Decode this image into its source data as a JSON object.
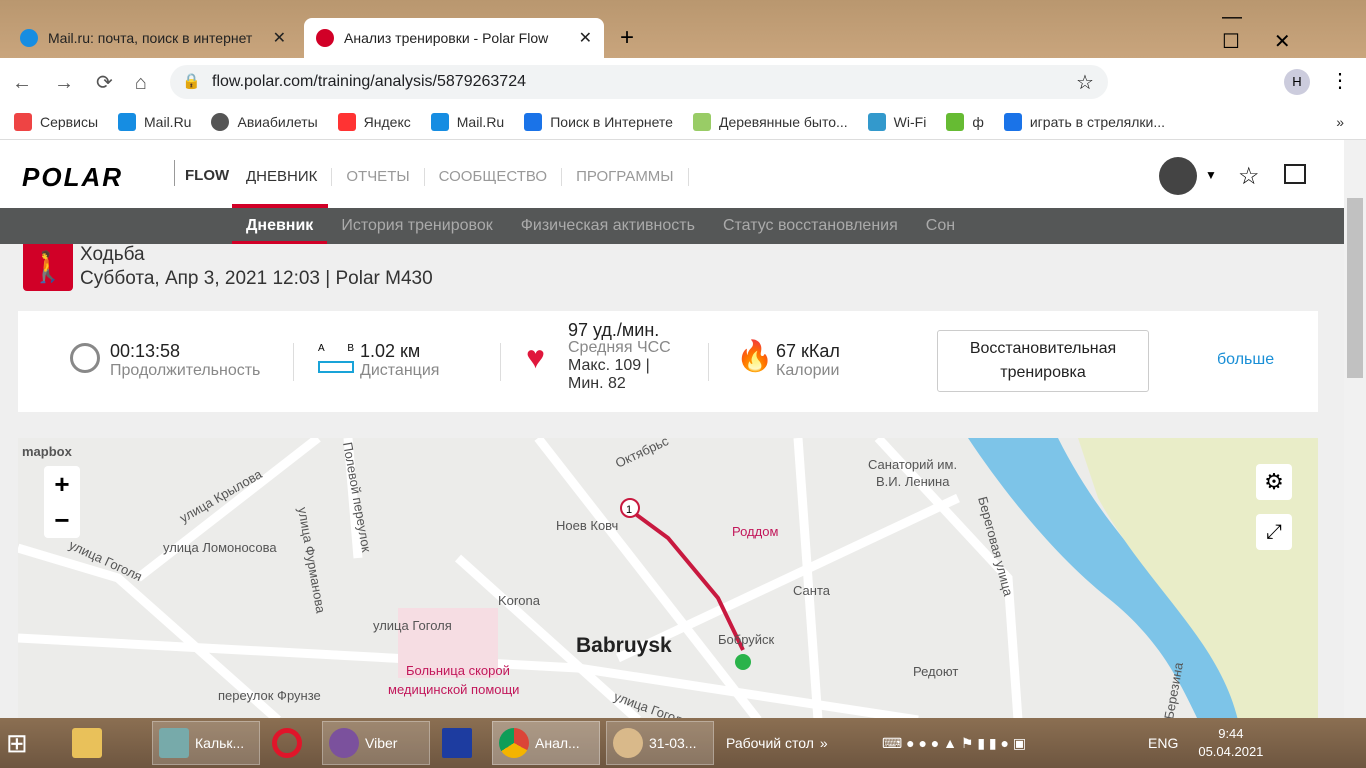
{
  "browser": {
    "tabs": [
      {
        "title": "Mail.ru: почта, поиск в интернет",
        "active": false
      },
      {
        "title": "Анализ тренировки - Polar Flow",
        "active": true
      }
    ],
    "url": "flow.polar.com/training/analysis/5879263724",
    "profile_initial": "Н",
    "bookmarks": [
      {
        "label": "Сервисы",
        "color": "#e44"
      },
      {
        "label": "Mail.Ru",
        "color": "#168de2"
      },
      {
        "label": "Авиабилеты",
        "color": "#555"
      },
      {
        "label": "Яндекс",
        "color": "#f33"
      },
      {
        "label": "Mail.Ru",
        "color": "#168de2"
      },
      {
        "label": "Поиск в Интернете",
        "color": "#1a73e8"
      },
      {
        "label": "Деревянные быто...",
        "color": "#9c6"
      },
      {
        "label": "Wi-Fi",
        "color": "#39c"
      },
      {
        "label": "ф",
        "color": "#6b3"
      },
      {
        "label": "играть в стрелялки...",
        "color": "#1a73e8"
      }
    ]
  },
  "polar": {
    "logo": "POLAR",
    "flow": "FLOW",
    "nav": [
      "ДНЕВНИК",
      "ОТЧЕТЫ",
      "СООБЩЕСТВО",
      "ПРОГРАММЫ"
    ],
    "subnav": [
      "Дневник",
      "История тренировок",
      "Физическая активность",
      "Статус восстановления",
      "Сон"
    ],
    "accent": "#d10027"
  },
  "training": {
    "sport": "Ходьба",
    "subtitle": "Суббота, Апр 3, 2021 12:03 | Polar M430",
    "duration": {
      "value": "00:13:58",
      "label": "Продолжительность"
    },
    "distance": {
      "value": "1.02 км",
      "label": "Дистанция",
      "a": "A",
      "b": "B"
    },
    "hr": {
      "value": "97 уд./мин.",
      "label": "Средняя ЧСС",
      "max": "Макс. 109  |",
      "min": "Мин. 82"
    },
    "calories": {
      "value": "67 кКал",
      "label": "Калории"
    },
    "benefit": "Восстановительная тренировка",
    "more": "больше"
  },
  "map": {
    "attribution": "mapbox",
    "zoom_in": "+",
    "zoom_out": "−",
    "lap": "1",
    "labels": [
      "улица Крылова",
      "Полевой переулок",
      "улица Фурманова",
      "улица Ломоносова",
      "улица Гоголя",
      "Ноев Ковч",
      "Октябрьс",
      "Роддом",
      "Санаторий им.",
      "В.И. Ленина",
      "Береговая улица",
      "Санта",
      "Korona",
      "улица Гоголя",
      "Babruysk",
      "Бобруйск",
      "Больница скорой",
      "медицинской помощи",
      "переулок Фрунзе",
      "улица Гоголя",
      "Редоют",
      "Березина"
    ]
  },
  "taskbar": {
    "items": [
      "Кальк...",
      "Viber",
      "Анал...",
      "31-03..."
    ],
    "desktop": "Рабочий стол",
    "lang": "ENG",
    "time": "9:44",
    "date": "05.04.2021"
  }
}
